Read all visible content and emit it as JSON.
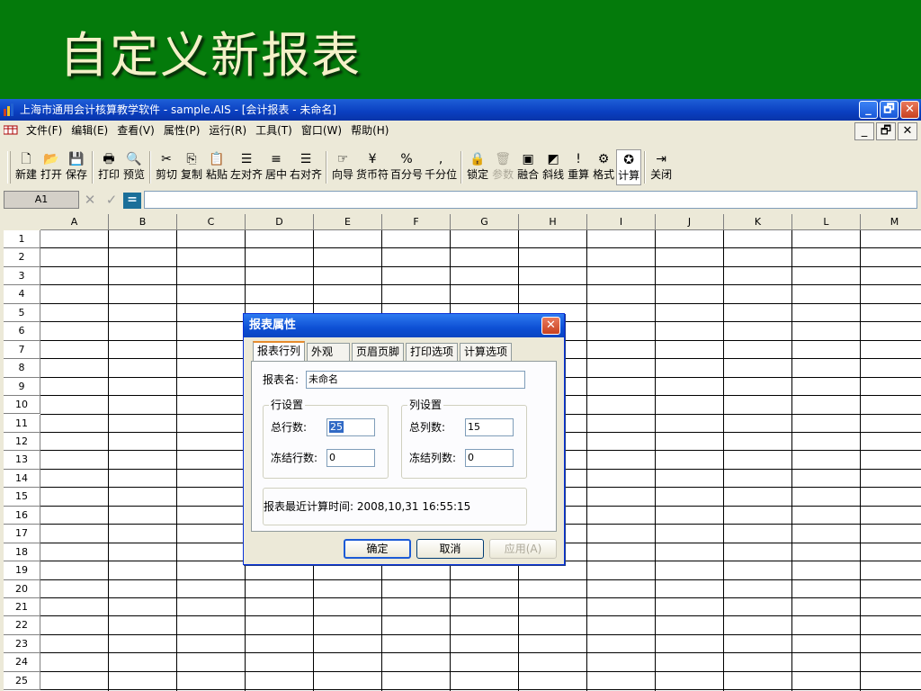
{
  "slide": {
    "title": "自定义新报表"
  },
  "window": {
    "title": "上海市通用会计核算教学软件 - sample.AIS - [会计报表 - 未命名]",
    "buttons": {
      "minimize": "_",
      "restore": "🗗",
      "close": "✕"
    }
  },
  "menu": {
    "items": [
      "文件(F)",
      "编辑(E)",
      "查看(V)",
      "属性(P)",
      "运行(R)",
      "工具(T)",
      "窗口(W)",
      "帮助(H)"
    ],
    "mdi_buttons": {
      "minimize": "_",
      "restore": "🗗",
      "close": "✕"
    }
  },
  "toolbar": {
    "groups": [
      [
        {
          "label": "新建",
          "icon": "🗋"
        },
        {
          "label": "打开",
          "icon": "📂"
        },
        {
          "label": "保存",
          "icon": "💾"
        }
      ],
      [
        {
          "label": "打印",
          "icon": "🖶"
        },
        {
          "label": "预览",
          "icon": "🔍"
        }
      ],
      [
        {
          "label": "剪切",
          "icon": "✂"
        },
        {
          "label": "复制",
          "icon": "⎘"
        },
        {
          "label": "粘贴",
          "icon": "📋"
        },
        {
          "label": "左对齐",
          "icon": "☰"
        },
        {
          "label": "居中",
          "icon": "≡"
        },
        {
          "label": "右对齐",
          "icon": "☰"
        }
      ],
      [
        {
          "label": "向导",
          "icon": "☞"
        },
        {
          "label": "货币符",
          "icon": "¥"
        },
        {
          "label": "百分号",
          "icon": "%"
        },
        {
          "label": "千分位",
          "icon": ","
        }
      ],
      [
        {
          "label": "锁定",
          "icon": "🔒"
        },
        {
          "label": "参数",
          "icon": "🗑",
          "disabled": true
        },
        {
          "label": "融合",
          "icon": "▣"
        },
        {
          "label": "斜线",
          "icon": "◩"
        },
        {
          "label": "重算",
          "icon": "!"
        },
        {
          "label": "格式",
          "icon": "⚙"
        },
        {
          "label": "计算",
          "icon": "✪",
          "pressed": true
        }
      ],
      [
        {
          "label": "关闭",
          "icon": "⇥"
        }
      ]
    ]
  },
  "formula_bar": {
    "cell_ref": "A1",
    "cancel_icon": "✕",
    "accept_icon": "✓",
    "equal_icon": "="
  },
  "grid": {
    "columns": [
      "A",
      "B",
      "C",
      "D",
      "E",
      "F",
      "G",
      "H",
      "I",
      "J",
      "K",
      "L",
      "M"
    ],
    "rows": [
      "1",
      "2",
      "3",
      "4",
      "5",
      "6",
      "7",
      "8",
      "9",
      "10",
      "11",
      "12",
      "13",
      "14",
      "15",
      "16",
      "17",
      "18",
      "19",
      "20",
      "21",
      "22",
      "23",
      "24",
      "25"
    ]
  },
  "dialog": {
    "title": "报表属性",
    "close_icon": "✕",
    "tabs": [
      "报表行列",
      "外观",
      "页眉页脚",
      "打印选项",
      "计算选项"
    ],
    "report_name_label": "报表名:",
    "report_name_value": "未命名",
    "row_group_title": "行设置",
    "total_rows_label": "总行数:",
    "total_rows_value": "25",
    "frozen_rows_label": "冻结行数:",
    "frozen_rows_value": "0",
    "col_group_title": "列设置",
    "total_cols_label": "总列数:",
    "total_cols_value": "15",
    "frozen_cols_label": "冻结列数:",
    "frozen_cols_value": "0",
    "last_calc_text": "报表最近计算时间: 2008,10,31 16:55:15",
    "ok_label": "确定",
    "cancel_label": "取消",
    "apply_label": "应用(A)"
  }
}
